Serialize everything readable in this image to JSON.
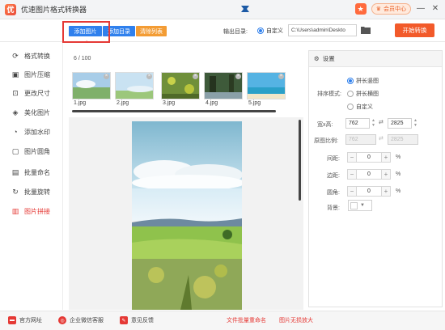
{
  "app": {
    "title": "优速图片格式转换器"
  },
  "header": {
    "member_label": "会员中心",
    "minimize": "—",
    "close": "✕"
  },
  "toolbar": {
    "add_images": "添加图片",
    "add_folder": "添加目录",
    "clear_list": "清除列表",
    "output_label": "输出目录:",
    "output_option": "自定义",
    "output_path": "C:\\Users\\admin\\Deskto",
    "start_button": "开始转换"
  },
  "sidebar": {
    "items": [
      {
        "label": "格式转换",
        "icon": "refresh-icon"
      },
      {
        "label": "图片压缩",
        "icon": "compress-icon"
      },
      {
        "label": "更改尺寸",
        "icon": "resize-icon"
      },
      {
        "label": "美化图片",
        "icon": "beautify-icon"
      },
      {
        "label": "添加水印",
        "icon": "watermark-icon"
      },
      {
        "label": "图片圆角",
        "icon": "round-corner-icon"
      },
      {
        "label": "批量命名",
        "icon": "rename-icon"
      },
      {
        "label": "批量旋转",
        "icon": "rotate-icon"
      },
      {
        "label": "图片拼接",
        "icon": "splice-icon"
      }
    ],
    "active_index": 8
  },
  "main": {
    "count": "6 / 100",
    "thumbnails": [
      "1.jpg",
      "2.jpg",
      "3.jpg",
      "4.jpg",
      "5.jpg"
    ]
  },
  "settings": {
    "title": "设置",
    "order_label": "排序模式:",
    "order_options": [
      "拼长竖图",
      "拼长横图",
      "自定义"
    ],
    "order_selected": 0,
    "size_label": "宽x高:",
    "width": "762",
    "height": "2825",
    "ratio_label": "原图比例:",
    "ratio_w": "762",
    "ratio_h": "2825",
    "gap_label": "间距:",
    "gap_value": "0",
    "margin_label": "边距:",
    "margin_value": "0",
    "radius_label": "圆角:",
    "radius_value": "0",
    "percent": "%",
    "bg_label": "背景:"
  },
  "footer": {
    "website": "官方网址",
    "wechat": "企业微信客服",
    "feedback": "意见反馈",
    "batch_rename": "文件批量重命名",
    "lossless_zoom": "图片无损放大"
  },
  "colors": {
    "primary": "#2f80ed",
    "orange": "#f39c34",
    "start": "#f25a2a",
    "highlight": "#e53935"
  }
}
